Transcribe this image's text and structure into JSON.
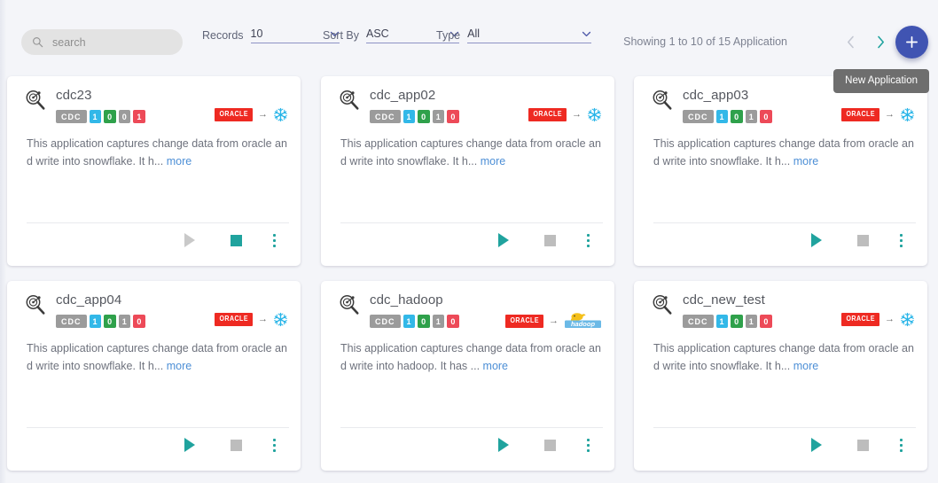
{
  "toolbar": {
    "search": {
      "placeholder": "search",
      "value": "",
      "icon": "search-icon"
    },
    "records": {
      "label": "Records",
      "value": "10",
      "icon": "chevron-down-icon"
    },
    "sort_by": {
      "label": "Sort By",
      "value": "ASC",
      "icon": "chevron-down-icon"
    },
    "type": {
      "label": "Type",
      "value": "All",
      "icon": "chevron-down-icon"
    },
    "showing": "Showing 1 to 10 of 15 Application",
    "prev": {
      "icon": "chevron-left-icon",
      "enabled": false
    },
    "next": {
      "icon": "chevron-right-icon",
      "enabled": true
    },
    "new_application": {
      "icon": "plus-icon",
      "tooltip": "New Application"
    }
  },
  "colors": {
    "accent": "#4054b2",
    "teal": "#20a39e",
    "cyan": "#32b8e8",
    "green": "#2fa14b",
    "grey": "#9b9b9b",
    "red": "#ed4a58",
    "oracle_red": "#ee2a22",
    "snowflake_blue": "#29b5e8",
    "link_blue": "#4d8fd6",
    "page_bg": "#f4f5f9",
    "card_bg": "#ffffff"
  },
  "cards": [
    {
      "name": "cdc23",
      "icon": "app-magnifier-icon",
      "badges": [
        {
          "label": "CDC",
          "color": "#9b9b9b",
          "kind": "type"
        },
        {
          "label": "1",
          "color": "#32b8e8",
          "kind": "count"
        },
        {
          "label": "0",
          "color": "#2fa14b",
          "kind": "count"
        },
        {
          "label": "0",
          "color": "#9b9b9b",
          "kind": "count"
        },
        {
          "label": "1",
          "color": "#ed4a58",
          "kind": "count"
        }
      ],
      "source": "ORACLE",
      "target": "snowflake",
      "description": "This application captures change data from oracle and write into snowflake. It h...",
      "more_label": "more",
      "play_enabled": false,
      "stop_enabled": true
    },
    {
      "name": "cdc_app02",
      "icon": "app-magnifier-icon",
      "badges": [
        {
          "label": "CDC",
          "color": "#9b9b9b",
          "kind": "type"
        },
        {
          "label": "1",
          "color": "#32b8e8",
          "kind": "count"
        },
        {
          "label": "0",
          "color": "#2fa14b",
          "kind": "count"
        },
        {
          "label": "1",
          "color": "#9b9b9b",
          "kind": "count"
        },
        {
          "label": "0",
          "color": "#ed4a58",
          "kind": "count"
        }
      ],
      "source": "ORACLE",
      "target": "snowflake",
      "description": "This application captures change data from oracle and write into snowflake. It h...",
      "more_label": "more",
      "play_enabled": true,
      "stop_enabled": false
    },
    {
      "name": "cdc_app03",
      "icon": "app-magnifier-icon",
      "badges": [
        {
          "label": "CDC",
          "color": "#9b9b9b",
          "kind": "type"
        },
        {
          "label": "1",
          "color": "#32b8e8",
          "kind": "count"
        },
        {
          "label": "0",
          "color": "#2fa14b",
          "kind": "count"
        },
        {
          "label": "1",
          "color": "#9b9b9b",
          "kind": "count"
        },
        {
          "label": "0",
          "color": "#ed4a58",
          "kind": "count"
        }
      ],
      "source": "ORACLE",
      "target": "snowflake",
      "description": "This application captures change data from oracle and write into snowflake. It h...",
      "more_label": "more",
      "play_enabled": true,
      "stop_enabled": false
    },
    {
      "name": "cdc_app04",
      "icon": "app-magnifier-icon",
      "badges": [
        {
          "label": "CDC",
          "color": "#9b9b9b",
          "kind": "type"
        },
        {
          "label": "1",
          "color": "#32b8e8",
          "kind": "count"
        },
        {
          "label": "0",
          "color": "#2fa14b",
          "kind": "count"
        },
        {
          "label": "1",
          "color": "#9b9b9b",
          "kind": "count"
        },
        {
          "label": "0",
          "color": "#ed4a58",
          "kind": "count"
        }
      ],
      "source": "ORACLE",
      "target": "snowflake",
      "description": "This application captures change data from oracle and write into snowflake. It h...",
      "more_label": "more",
      "play_enabled": true,
      "stop_enabled": false
    },
    {
      "name": "cdc_hadoop",
      "icon": "app-magnifier-icon",
      "badges": [
        {
          "label": "CDC",
          "color": "#9b9b9b",
          "kind": "type"
        },
        {
          "label": "1",
          "color": "#32b8e8",
          "kind": "count"
        },
        {
          "label": "0",
          "color": "#2fa14b",
          "kind": "count"
        },
        {
          "label": "1",
          "color": "#9b9b9b",
          "kind": "count"
        },
        {
          "label": "0",
          "color": "#ed4a58",
          "kind": "count"
        }
      ],
      "source": "ORACLE",
      "target": "hadoop",
      "description": "This application captures change data from oracle and write into hadoop. It has ...",
      "more_label": "more",
      "play_enabled": true,
      "stop_enabled": false
    },
    {
      "name": "cdc_new_test",
      "icon": "app-magnifier-icon",
      "badges": [
        {
          "label": "CDC",
          "color": "#9b9b9b",
          "kind": "type"
        },
        {
          "label": "1",
          "color": "#32b8e8",
          "kind": "count"
        },
        {
          "label": "0",
          "color": "#2fa14b",
          "kind": "count"
        },
        {
          "label": "1",
          "color": "#9b9b9b",
          "kind": "count"
        },
        {
          "label": "0",
          "color": "#ed4a58",
          "kind": "count"
        }
      ],
      "source": "ORACLE",
      "target": "snowflake",
      "description": "This application captures change data from oracle and write into snowflake. It h...",
      "more_label": "more",
      "play_enabled": true,
      "stop_enabled": false
    }
  ]
}
